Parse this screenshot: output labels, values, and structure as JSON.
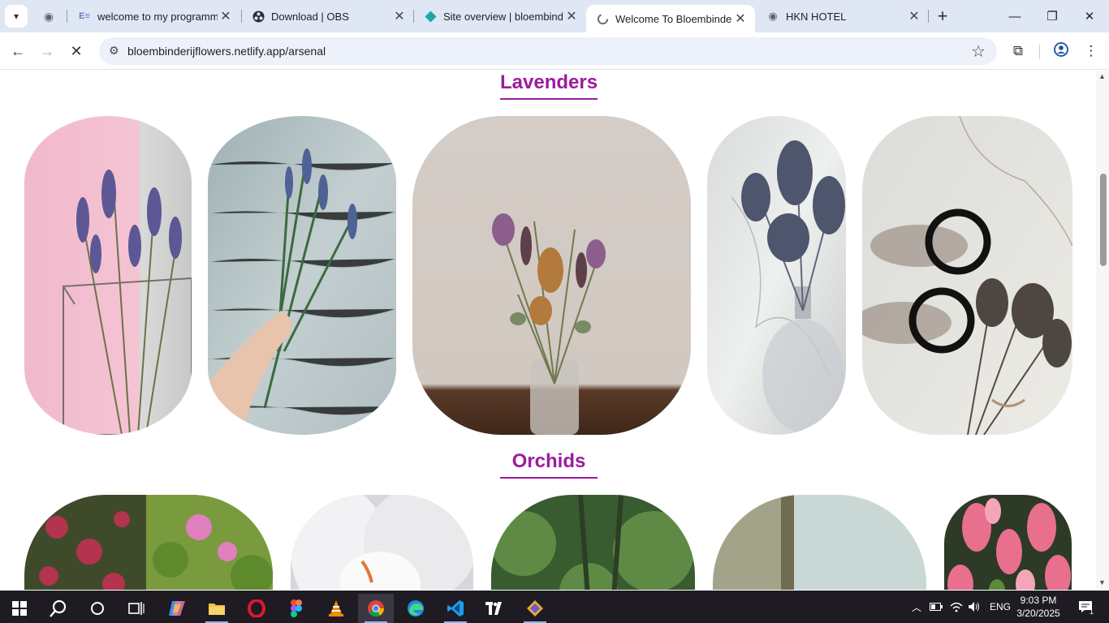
{
  "browser": {
    "tabs": [
      {
        "title": "welcome to my programm",
        "icon": "elementor-icon"
      },
      {
        "title": "Download | OBS",
        "icon": "obs-icon"
      },
      {
        "title": "Site overview | bloembinde",
        "icon": "netlify-icon"
      },
      {
        "title": "Welcome To Bloembinderij",
        "icon": "page-loading-icon",
        "active": true
      },
      {
        "title": "HKN HOTEL",
        "icon": "globe-icon"
      }
    ],
    "address": "bloembinderijflowers.netlify.app/arsenal"
  },
  "page": {
    "sections": [
      {
        "title": "Lavenders"
      },
      {
        "title": "Orchids"
      }
    ]
  },
  "taskbar": {
    "apps": [
      "windows-start",
      "search",
      "cortana",
      "task-view",
      "copilot",
      "file-explorer",
      "opera",
      "figma",
      "vlc",
      "chrome",
      "edge",
      "vscode",
      "tradingview",
      "app-launcher"
    ],
    "language": "ENG",
    "time": "9:03 PM",
    "date": "3/20/2025",
    "notifications": "1"
  },
  "colors": {
    "section_title": "#9c1b9e",
    "tabstrip": "#dfe7f5",
    "omnibox": "#edf2fa",
    "taskbar": "#1e1b22"
  }
}
